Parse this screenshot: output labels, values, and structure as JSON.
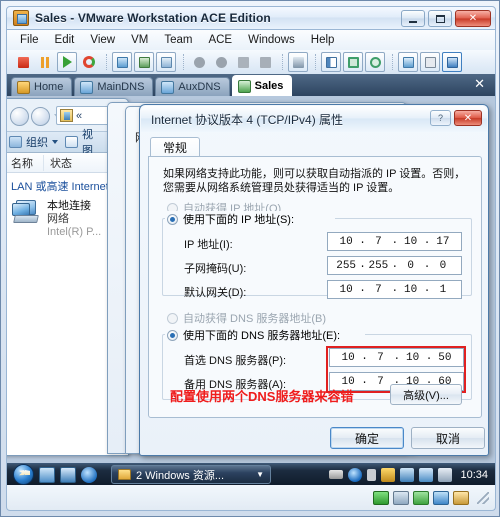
{
  "window": {
    "title": "Sales - VMware Workstation ACE Edition",
    "icon": "vmware-window-icon",
    "controls": {
      "minimize": "minimize-button",
      "maximize": "maximize-button",
      "close": "close-button"
    }
  },
  "menubar": {
    "items": [
      "File",
      "Edit",
      "View",
      "VM",
      "Team",
      "ACE",
      "Windows",
      "Help"
    ]
  },
  "toolbar": {
    "icons": [
      {
        "name": "power-off-icon",
        "color": "#e03a2a"
      },
      {
        "name": "suspend-icon",
        "color": "#f0a32a"
      },
      {
        "name": "power-on-icon",
        "color": "#3fa63f"
      },
      {
        "name": "reset-icon",
        "color": "#e0452f"
      },
      {
        "name": "snapshot-take-icon",
        "color": "#6fa8d8"
      },
      {
        "name": "snapshot-revert-icon",
        "color": "#5fa05f"
      },
      {
        "name": "snapshot-manager-icon",
        "color": "#8fb4d6"
      },
      {
        "name": "team-icon",
        "color": "#9aa3ad"
      },
      {
        "name": "team-settings-icon",
        "color": "#9aa3ad"
      },
      {
        "name": "lan-segment-icon",
        "color": "#a0a8b2"
      },
      {
        "name": "connection-icon",
        "color": "#9aa3ad"
      },
      {
        "name": "capture-icon",
        "color": "#7f94a8"
      },
      {
        "name": "sidebar-toggle-icon",
        "color": "#4f86bd"
      },
      {
        "name": "full-screen-icon",
        "color": "#3f9e6a"
      },
      {
        "name": "quick-switch-icon",
        "color": "#3f9e6a"
      },
      {
        "name": "unity-icon",
        "color": "#5f9fd0"
      },
      {
        "name": "summary-view-icon",
        "color": "#7b8a99"
      },
      {
        "name": "console-view-icon",
        "color": "#3f7fc0"
      }
    ]
  },
  "tabs": {
    "items": [
      {
        "label": "Home",
        "icon": "home-tab-icon",
        "active": false
      },
      {
        "label": "MainDNS",
        "icon": "vm-tab-icon",
        "active": false
      },
      {
        "label": "AuxDNS",
        "icon": "vm-tab-icon",
        "active": false
      },
      {
        "label": "Sales",
        "icon": "vm-tab-icon",
        "active": true
      }
    ],
    "close_label": "✕"
  },
  "explorer": {
    "toolbar": {
      "organize": "组织",
      "views": "视图"
    },
    "columns": [
      "名称",
      "状态"
    ],
    "group_header": "LAN 或高速 Internet",
    "item": {
      "name": "本地连接",
      "status": "网络",
      "adapter": "Intel(R) P..."
    }
  },
  "tcp_dialog": {
    "title": "Internet 协议版本 4 (TCP/IPv4) 属性",
    "help_label": "?",
    "close_label": "✕",
    "tab": "常规",
    "description": "如果网络支持此功能，则可以获取自动指派的 IP 设置。否则，您需要从网络系统管理员处获得适当的 IP 设置。",
    "ip_auto_label": "自动获得 IP 地址(O)",
    "ip_manual_label": "使用下面的 IP 地址(S):",
    "ip_auto_selected": false,
    "ip_manual_selected": true,
    "fields": [
      {
        "label": "IP 地址(I):",
        "octets": [
          "10",
          "7",
          "10",
          "17"
        ]
      },
      {
        "label": "子网掩码(U):",
        "octets": [
          "255",
          "255",
          "0",
          "0"
        ]
      },
      {
        "label": "默认网关(D):",
        "octets": [
          "10",
          "7",
          "10",
          "1"
        ]
      }
    ],
    "dns_auto_label": "自动获得 DNS 服务器地址(B)",
    "dns_manual_label": "使用下面的 DNS 服务器地址(E):",
    "dns_auto_selected": false,
    "dns_manual_selected": true,
    "dns_fields": [
      {
        "label": "首选 DNS 服务器(P):",
        "octets": [
          "10",
          "7",
          "10",
          "50"
        ]
      },
      {
        "label": "备用 DNS 服务器(A):",
        "octets": [
          "10",
          "7",
          "10",
          "60"
        ]
      }
    ],
    "annotation": "配置使用两个DNS服务器来容错",
    "annotation_color": "#ef1c1c",
    "highlight_color": "#e02020",
    "advanced_button": "高级(V)...",
    "ok_button": "确定",
    "cancel_button": "取消"
  },
  "taskbar": {
    "start": "start-orb",
    "quick_launch": [
      "show-desktop-icon",
      "switch-window-icon",
      "internet-explorer-icon"
    ],
    "task_label": "2 Windows 资源...",
    "task_icon": "folder-icon",
    "tray": [
      "keyboard-icon",
      "help-icon",
      "updates-icon",
      "security-icon",
      "network-sync-icon",
      "network-icon",
      "volume-muted-icon"
    ],
    "clock": "10:34"
  },
  "statusbar": {
    "icons": [
      "hard-disk-icon",
      "cd-dvd-icon",
      "network-adapter-icon",
      "sound-icon",
      "usb-icon"
    ]
  }
}
